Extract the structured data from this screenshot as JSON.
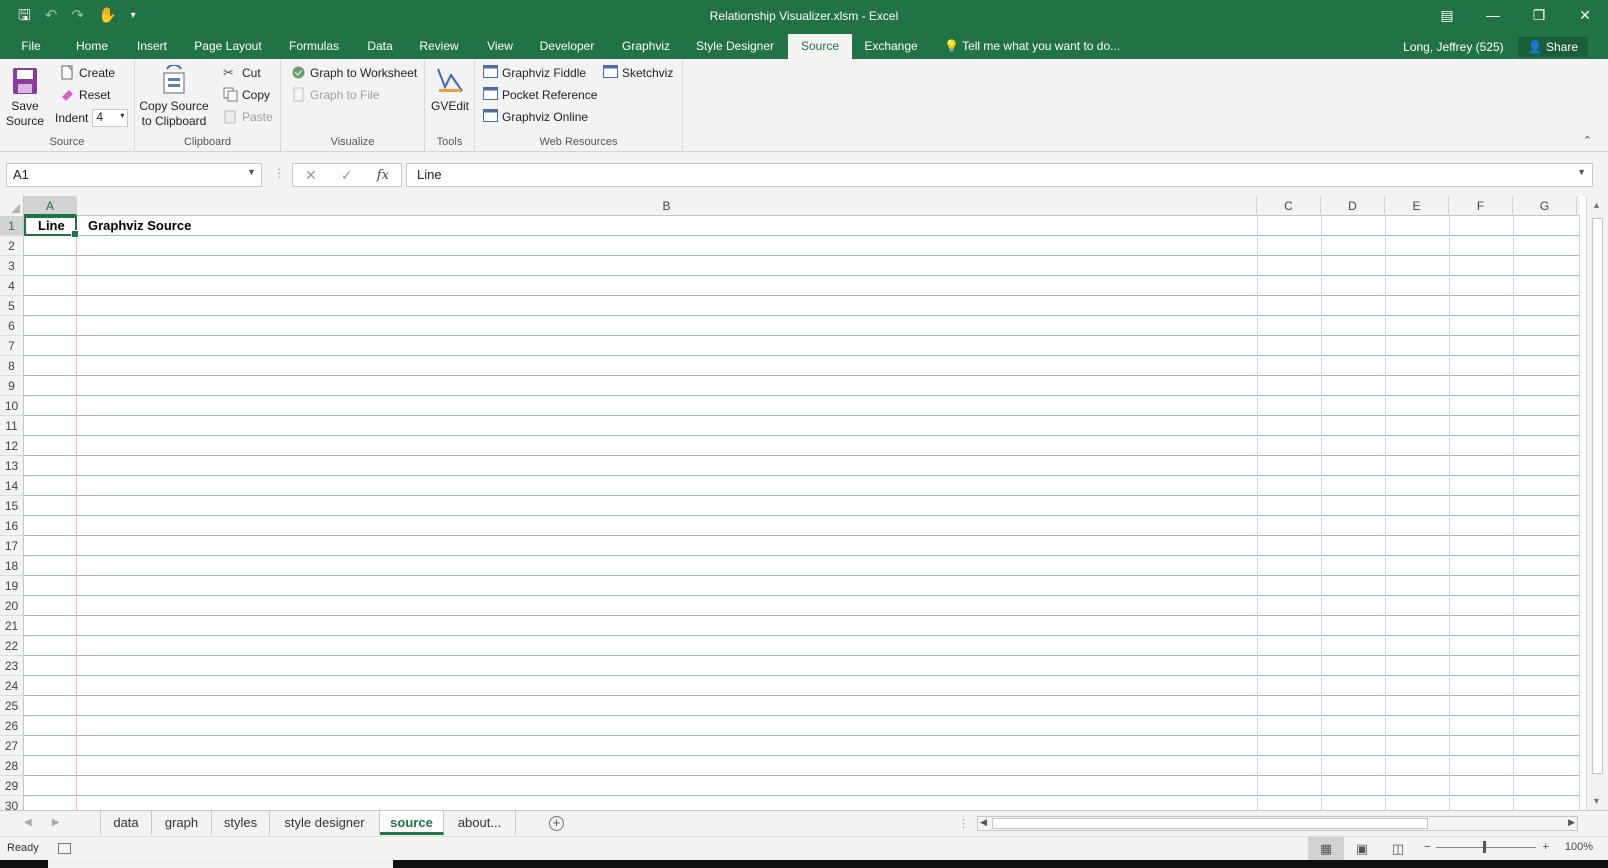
{
  "window": {
    "title": "Relationship Visualizer.xlsm - Excel",
    "controls": [
      "restore-ribbon-icon",
      "minimize-icon",
      "maximize-icon",
      "close-icon"
    ]
  },
  "qat": {
    "icons": [
      "save-icon",
      "undo-icon",
      "redo-icon",
      "touch-mode-icon",
      "customize-qat-icon"
    ]
  },
  "tabs": [
    "File",
    "Home",
    "Insert",
    "Page Layout",
    "Formulas",
    "Data",
    "Review",
    "View",
    "Developer",
    "Graphviz",
    "Style Designer",
    "Source",
    "Exchange"
  ],
  "active_tab": "Source",
  "tell_me": "Tell me what you want to do...",
  "user": "Long, Jeffrey (525)",
  "share_label": "Share",
  "ribbon": {
    "source": {
      "label": "Source",
      "save_source": "Save Source",
      "create": "Create",
      "reset": "Reset",
      "indent_label": "Indent",
      "indent_value": "4"
    },
    "clipboard": {
      "label": "Clipboard",
      "copy_source": "Copy Source to Clipboard",
      "cut": "Cut",
      "copy": "Copy",
      "paste": "Paste"
    },
    "visualize": {
      "label": "Visualize",
      "graph_to_worksheet": "Graph to Worksheet",
      "graph_to_file": "Graph to File"
    },
    "tools": {
      "label": "Tools",
      "gvedit": "GVEdit"
    },
    "web_resources": {
      "label": "Web Resources",
      "graphviz_fiddle": "Graphviz Fiddle",
      "sketchviz": "Sketchviz",
      "pocket_reference": "Pocket Reference",
      "graphviz_online": "Graphviz Online"
    }
  },
  "formula_bar": {
    "name_box": "A1",
    "content": "Line"
  },
  "grid": {
    "columns": [
      "A",
      "B",
      "C",
      "D",
      "E",
      "F",
      "G"
    ],
    "selected_column": "A",
    "rows": [
      "1",
      "2",
      "3",
      "4",
      "5",
      "6",
      "7",
      "8",
      "9",
      "10",
      "11",
      "12",
      "13",
      "14",
      "15",
      "16",
      "17",
      "18",
      "19",
      "20",
      "21",
      "22",
      "23",
      "24",
      "25",
      "26",
      "27",
      "28",
      "29",
      "30"
    ],
    "selected_row": "1",
    "cells": {
      "A1": "Line",
      "B1": "Graphviz Source"
    }
  },
  "sheets": [
    "data",
    "graph",
    "styles",
    "style designer",
    "source",
    "about..."
  ],
  "active_sheet": "source",
  "status": {
    "ready": "Ready",
    "zoom": "100%"
  },
  "colors": {
    "excel_green": "#217346",
    "ribbon_bg": "#f3f3f3",
    "grid_line_blue": "#9db4d8"
  }
}
